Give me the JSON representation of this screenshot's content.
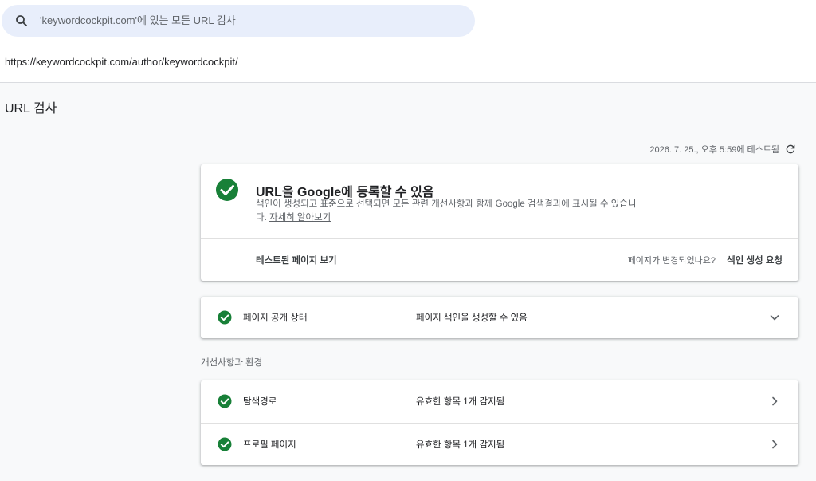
{
  "search": {
    "placeholder": "'keywordcockpit.com'에 있는 모든 URL 검사"
  },
  "inspected_url": "https://keywordcockpit.com/author/keywordcockpit/",
  "page_title": "URL 검사",
  "tested_time": "2026. 7. 25., 오후 5:59에 테스트됨",
  "main_card": {
    "headline": "URL을 Google에 등록할 수 있음",
    "description": "색인이 생성되고 표준으로 선택되면 모든 관련 개선사항과 함께 Google 검색결과에 표시될 수 있습니다.",
    "learn_more": "자세히 알아보기",
    "view_tested_page": "테스트된 페이지 보기",
    "page_changed_question": "페이지가 변경되었나요?",
    "request_indexing": "색인 생성 요청"
  },
  "availability": {
    "label": "페이지 공개 상태",
    "value": "페이지 색인을 생성할 수 있음"
  },
  "enhancements": {
    "section_label": "개선사항과 환경",
    "items": [
      {
        "label": "탐색경로",
        "value": "유효한 항목 1개 감지됨"
      },
      {
        "label": "프로필 페이지",
        "value": "유효한 항목 1개 감지됨"
      }
    ]
  },
  "colors": {
    "success_green": "#188038",
    "search_bg": "#e8eefb",
    "page_bg": "#f8f9fa"
  },
  "icons": [
    "search-icon",
    "refresh-icon",
    "check-circle-icon",
    "chevron-down-icon",
    "chevron-right-icon"
  ]
}
